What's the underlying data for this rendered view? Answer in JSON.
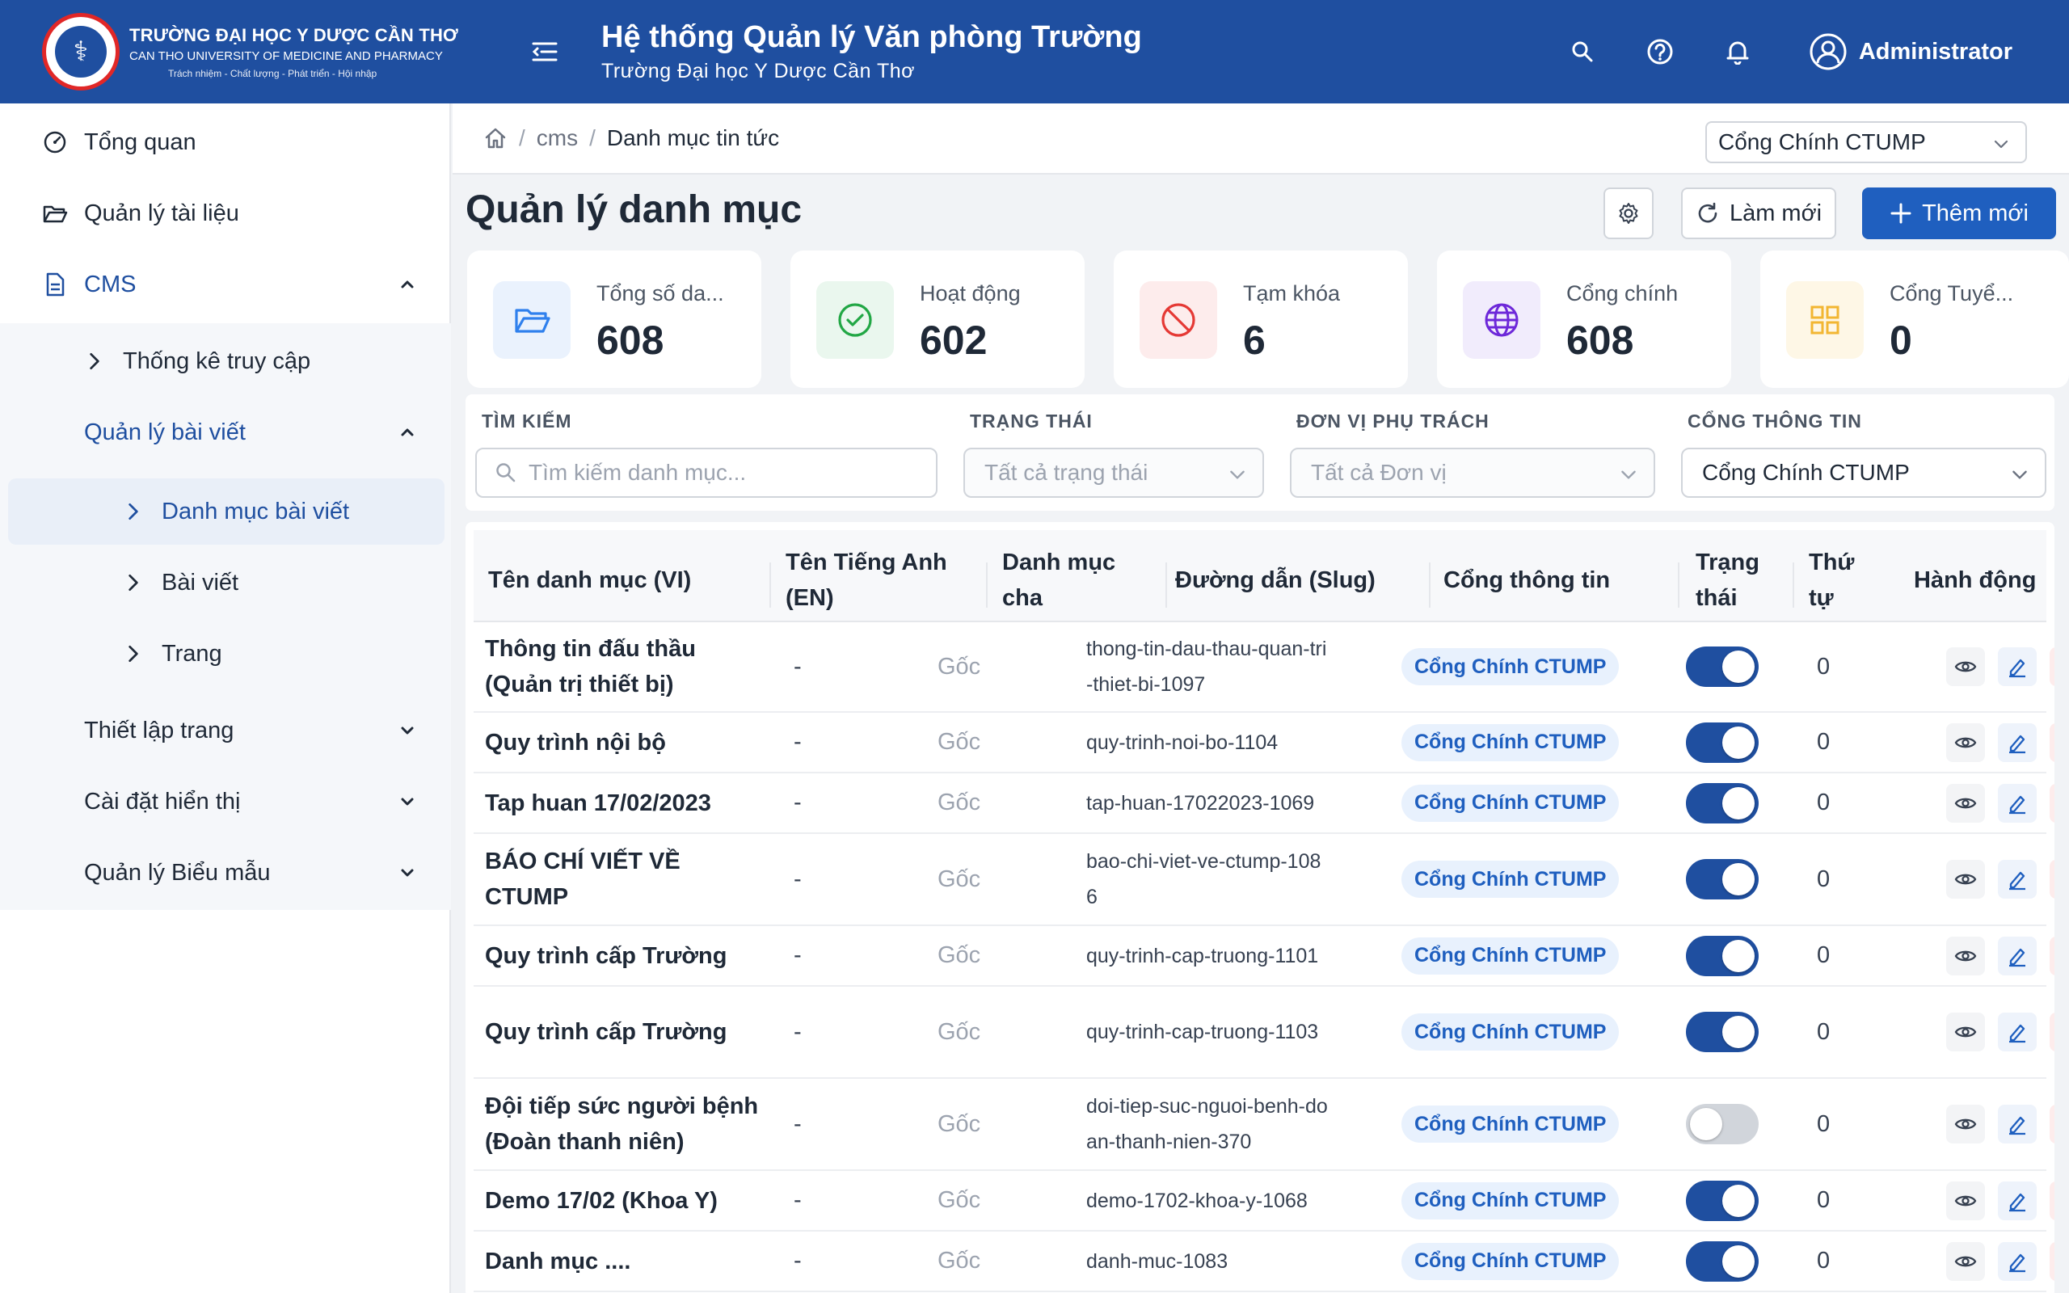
{
  "header": {
    "logo_line1": "TRƯỜNG ĐẠI HỌC Y DƯỢC CẦN THƠ",
    "logo_line2": "CAN THO UNIVERSITY OF MEDICINE AND PHARMACY",
    "logo_line3": "Trách nhiệm - Chất lượng - Phát triển - Hội nhập",
    "title": "Hệ thống Quản lý Văn phòng Trường",
    "subtitle": "Trường Đại học Y Dược Cần Thơ",
    "user_name": "Administrator"
  },
  "sidebar": {
    "items": [
      {
        "label": "Tổng quan"
      },
      {
        "label": "Quản lý tài liệu"
      },
      {
        "label": "CMS"
      },
      {
        "label": "Thống kê truy cập"
      },
      {
        "label": "Quản lý bài viết"
      },
      {
        "label": "Danh mục bài viết"
      },
      {
        "label": "Bài viết"
      },
      {
        "label": "Trang"
      },
      {
        "label": "Thiết lập trang"
      },
      {
        "label": "Cài đặt hiển thị"
      },
      {
        "label": "Quản lý Biểu mẫu"
      }
    ]
  },
  "breadcrumb": {
    "level1": "cms",
    "current": "Danh mục tin tức",
    "sep": "/"
  },
  "portal_select": {
    "value": "Cổng Chính CTUMP"
  },
  "page": {
    "title": "Quản lý danh mục",
    "refresh_label": "Làm mới",
    "add_label": "Thêm mới"
  },
  "stats": [
    {
      "label": "Tổng số da...",
      "value": "608",
      "color": "#2f80ed"
    },
    {
      "label": "Hoạt động",
      "value": "602",
      "color": "#22a745"
    },
    {
      "label": "Tạm khóa",
      "value": "6",
      "color": "#e53935"
    },
    {
      "label": "Cổng chính",
      "value": "608",
      "color": "#6d28d9"
    },
    {
      "label": "Cổng Tuyể...",
      "value": "0",
      "color": "#f2b632"
    }
  ],
  "filters": {
    "search_label": "TÌM KIẾM",
    "search_placeholder": "Tìm kiếm danh mục...",
    "status_label": "TRẠNG THÁI",
    "status_value": "Tất cả trạng thái",
    "unit_label": "ĐƠN VỊ PHỤ TRÁCH",
    "unit_value": "Tất cả Đơn vị",
    "portal_label": "CỔNG THÔNG TIN",
    "portal_value": "Cổng Chính CTUMP"
  },
  "table": {
    "headers": {
      "name": "Tên danh mục (VI)",
      "en": "Tên Tiếng Anh (EN)",
      "parent": "Danh mục cha",
      "slug": "Đường dẫn (Slug)",
      "portal": "Cổng thông tin",
      "status": "Trạng thái",
      "order": "Thứ tự",
      "actions": "Hành động"
    },
    "rows": [
      {
        "name": "Thông tin đấu thầu (Quản trị thiết bị)",
        "en": "-",
        "parent": "Gốc",
        "slug": "thong-tin-dau-thau-quan-tri-thiet-bi-1097",
        "portal": "Cổng Chính CTUMP",
        "active": true,
        "order": "0"
      },
      {
        "name": "Quy trình nội bộ",
        "en": "-",
        "parent": "Gốc",
        "slug": "quy-trinh-noi-bo-1104",
        "portal": "Cổng Chính CTUMP",
        "active": true,
        "order": "0"
      },
      {
        "name": "Tap huan 17/02/2023",
        "en": "-",
        "parent": "Gốc",
        "slug": "tap-huan-17022023-1069",
        "portal": "Cổng Chính CTUMP",
        "active": true,
        "order": "0"
      },
      {
        "name": "BÁO CHÍ VIẾT VỀ CTUMP",
        "en": "-",
        "parent": "Gốc",
        "slug": "bao-chi-viet-ve-ctump-1086",
        "portal": "Cổng Chính CTUMP",
        "active": true,
        "order": "0"
      },
      {
        "name": "Quy trình cấp Trường",
        "en": "-",
        "parent": "Gốc",
        "slug": "quy-trinh-cap-truong-1101",
        "portal": "Cổng Chính CTUMP",
        "active": true,
        "order": "0"
      },
      {
        "name": "Quy trình cấp Trường",
        "en": "-",
        "parent": "Gốc",
        "slug": "quy-trinh-cap-truong-1103",
        "portal": "Cổng Chính CTUMP",
        "active": true,
        "order": "0"
      },
      {
        "name": "Đội tiếp sức người bệnh (Đoàn thanh niên)",
        "en": "-",
        "parent": "Gốc",
        "slug": "doi-tiep-suc-nguoi-benh-doan-thanh-nien-370",
        "portal": "Cổng Chính CTUMP",
        "active": false,
        "order": "0"
      },
      {
        "name": "Demo 17/02 (Khoa Y)",
        "en": "-",
        "parent": "Gốc",
        "slug": "demo-1702-khoa-y-1068",
        "portal": "Cổng Chính CTUMP",
        "active": true,
        "order": "0"
      },
      {
        "name": "Danh mục ....",
        "en": "-",
        "parent": "Gốc",
        "slug": "danh-muc-1083",
        "portal": "Cổng Chính CTUMP",
        "active": true,
        "order": "0"
      }
    ]
  }
}
